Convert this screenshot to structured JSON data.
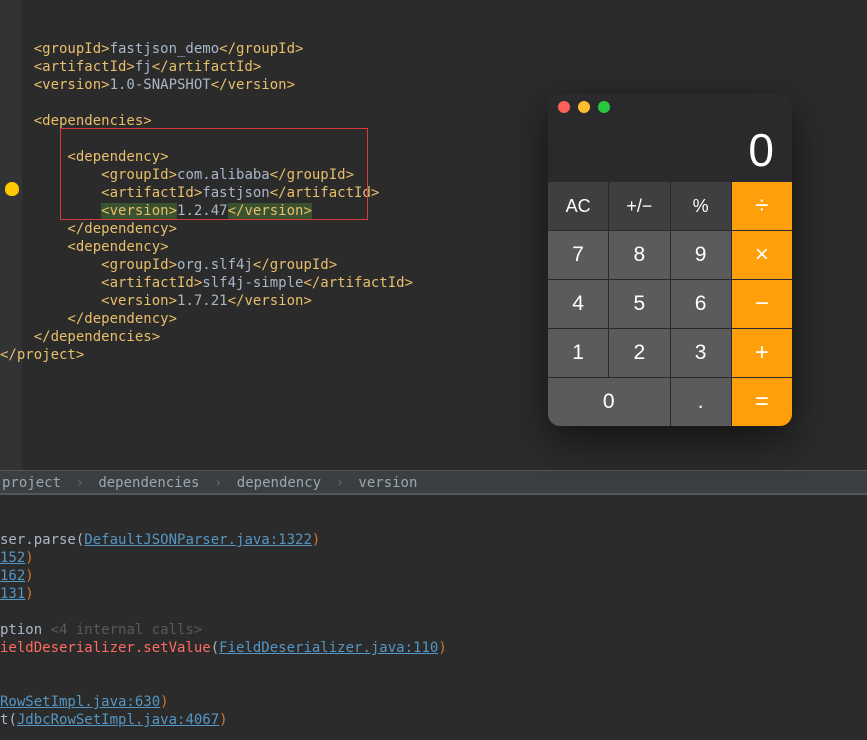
{
  "pom": {
    "groupId_label": "groupId",
    "groupId_value": "fastjson_demo",
    "artifactId_label": "artifactId",
    "artifactId_value": "fj",
    "version_label": "version",
    "version_value": "1.0-SNAPSHOT",
    "dependencies_label": "dependencies",
    "dependency_label": "dependency",
    "dep1": {
      "groupId": "com.alibaba",
      "artifactId": "fastjson",
      "version": "1.2.47"
    },
    "dep2": {
      "groupId": "org.slf4j",
      "artifactId": "slf4j-simple",
      "version": "1.7.21"
    },
    "project_close": "project"
  },
  "breadcrumb": {
    "b1": "project",
    "b2": "dependencies",
    "b3": "dependency",
    "b4": "version"
  },
  "console": {
    "l1a": "ser.parse",
    "l1b": "DefaultJSONParser.java:1322",
    "l2a": "152",
    "l3a": "162",
    "l4a": "131",
    "l5a": "ption",
    "l5b": "<4 internal calls>",
    "l6a": "ieldDeserializer.setValue",
    "l6b": "FieldDeserializer.java:110",
    "l7a": "RowSetImpl.java:630",
    "l8a": "t",
    "l8b": "JdbcRowSetImpl.java:4067"
  },
  "calc": {
    "display": "0",
    "ac": "AC",
    "sign": "+/−",
    "percent": "%",
    "divide": "÷",
    "n7": "7",
    "n8": "8",
    "n9": "9",
    "multiply": "×",
    "n4": "4",
    "n5": "5",
    "n6": "6",
    "minus": "−",
    "n1": "1",
    "n2": "2",
    "n3": "3",
    "plus": "+",
    "n0": "0",
    "dot": ".",
    "equals": "="
  }
}
